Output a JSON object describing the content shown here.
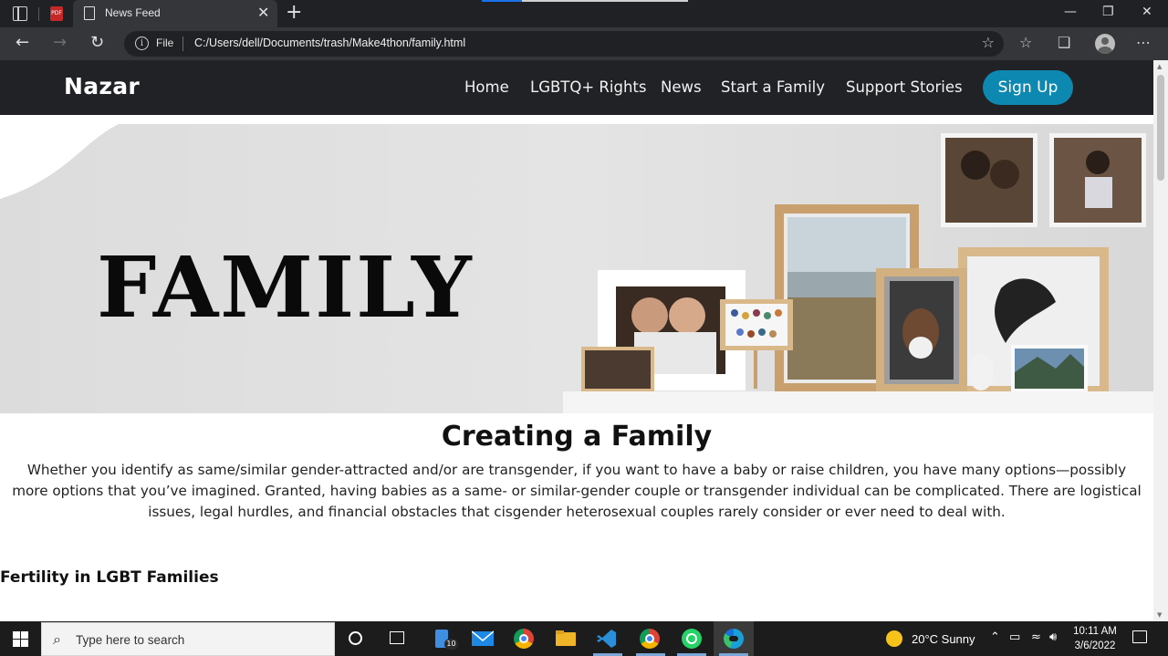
{
  "browser": {
    "tab_title": "News Feed",
    "address_prefix": "File",
    "url": "C:/Users/dell/Documents/trash/Make4thon/family.html"
  },
  "site": {
    "brand": "Nazar",
    "nav": [
      "Home",
      "LGBTQ+ Rights",
      "News",
      "Start a Family",
      "Support Stories"
    ],
    "signup_label": "Sign Up",
    "accent_color": "#0d88b0"
  },
  "hero": {
    "heading": "FAMILY"
  },
  "content": {
    "section_title": "Creating a Family",
    "intro": "Whether you identify as same/similar gender-attracted and/or are transgender, if you want to have a baby or raise children, you have many options—possibly more options that you’ve imagined. Granted, having babies as a same- or similar-gender couple or transgender individual can be complicated. There are logistical issues, legal hurdles, and financial obstacles that cisgender heterosexual couples rarely consider or ever need to deal with.",
    "subsection_title": "Fertility in LGBT Families"
  },
  "taskbar": {
    "search_placeholder": "Type here to search",
    "badge_count": "10",
    "weather": "20°C  Sunny",
    "time": "10:11 AM",
    "date": "3/6/2022"
  }
}
